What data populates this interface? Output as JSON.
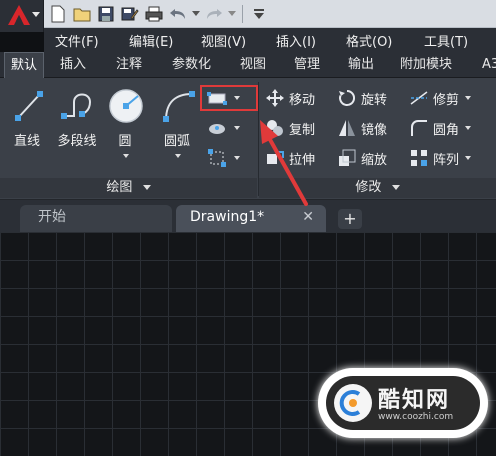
{
  "menu": {
    "items": [
      "文件(F)",
      "编辑(E)",
      "视图(V)",
      "插入(I)",
      "格式(O)",
      "工具(T)"
    ]
  },
  "ribbon_tabs": {
    "items": [
      "默认",
      "插入",
      "注释",
      "参数化",
      "视图",
      "管理",
      "输出",
      "附加模块",
      "A3"
    ],
    "active": "默认"
  },
  "draw_panel": {
    "title": "绘图",
    "tools": [
      "直线",
      "多段线",
      "圆",
      "圆弧"
    ]
  },
  "modify_panel": {
    "title": "修改",
    "tools": [
      "移动",
      "旋转",
      "修剪",
      "复制",
      "镜像",
      "圆角",
      "拉伸",
      "缩放",
      "阵列"
    ]
  },
  "document_tabs": {
    "start": "开始",
    "drawing": "Drawing1*",
    "close_glyph": "✕",
    "add_glyph": "+"
  },
  "watermark": {
    "title": "酷知网",
    "url": "www.coozhi.com"
  },
  "colors": {
    "accent_red": "#e03a3a",
    "ribbon_bg": "#3b4048",
    "canvas_bg": "#141619"
  }
}
